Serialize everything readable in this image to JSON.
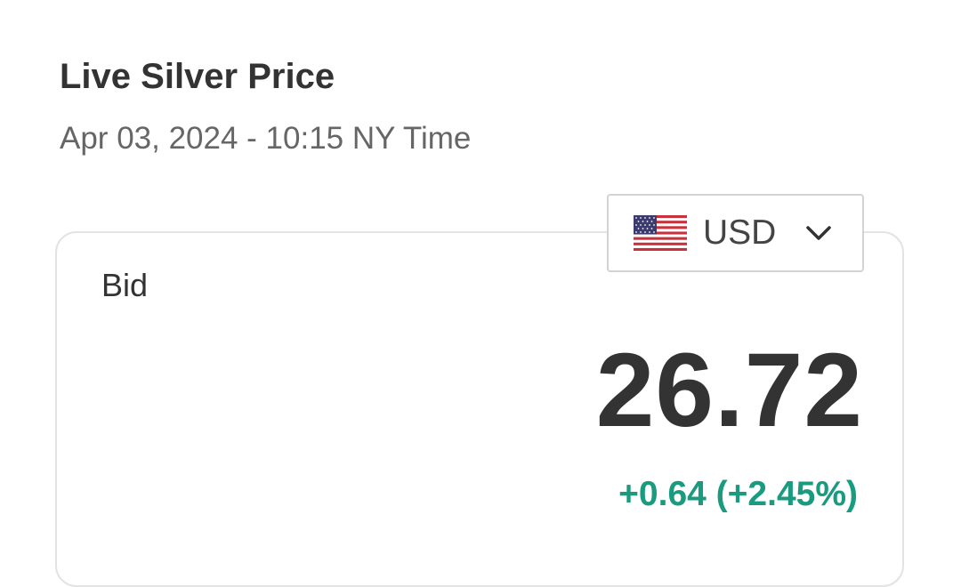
{
  "header": {
    "title": "Live Silver Price",
    "timestamp": "Apr 03, 2024 - 10:15 NY Time"
  },
  "currency_selector": {
    "selected": "USD",
    "flag_icon": "us-flag-icon",
    "dropdown_icon": "chevron-down-icon"
  },
  "quote": {
    "label": "Bid",
    "price": "26.72",
    "change": "+0.64 (+2.45%)",
    "change_color": "#1a9a7e"
  }
}
